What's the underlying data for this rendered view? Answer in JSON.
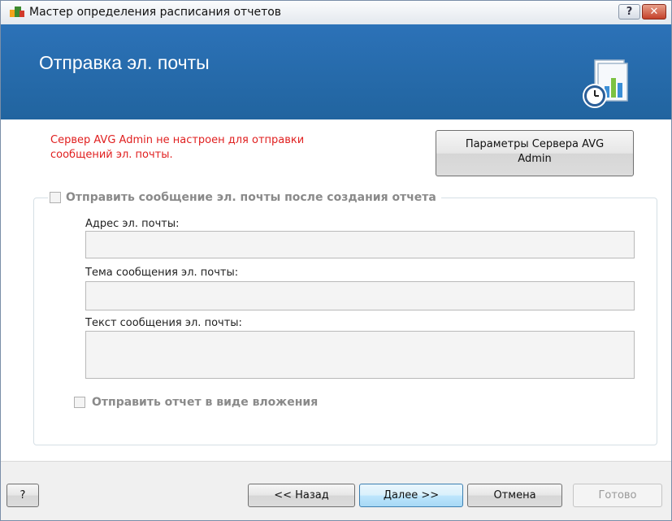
{
  "window": {
    "title": "Мастер определения расписания отчетов",
    "help_glyph": "?",
    "close_glyph": "✕"
  },
  "header": {
    "title": "Отправка эл. почты"
  },
  "content": {
    "error_line1": "Сервер AVG Admin не настроен для отправки",
    "error_line2": "сообщений эл. почты.",
    "server_button_line1": "Параметры Сервера AVG",
    "server_button_line2": "Admin",
    "send_email_checkbox": {
      "label": "Отправить сообщение эл. почты после создания отчета",
      "checked": false,
      "enabled": false
    },
    "fields": {
      "address_label": "Адрес эл. почты:",
      "address_value": "",
      "subject_label": "Тема сообщения эл. почты:",
      "subject_value": "",
      "body_label": "Текст сообщения эл. почты:",
      "body_value": ""
    },
    "attach_checkbox": {
      "label": "Отправить отчет в виде вложения",
      "checked": false,
      "enabled": false
    }
  },
  "footer": {
    "help_label": "?",
    "back_label": "<< Назад",
    "next_label": "Далее >>",
    "cancel_label": "Отмена",
    "finish_label": "Готово"
  },
  "colors": {
    "header_blue": "#2a6fb2",
    "error_red": "#e02020",
    "disabled_gray": "#8a8a8a"
  }
}
